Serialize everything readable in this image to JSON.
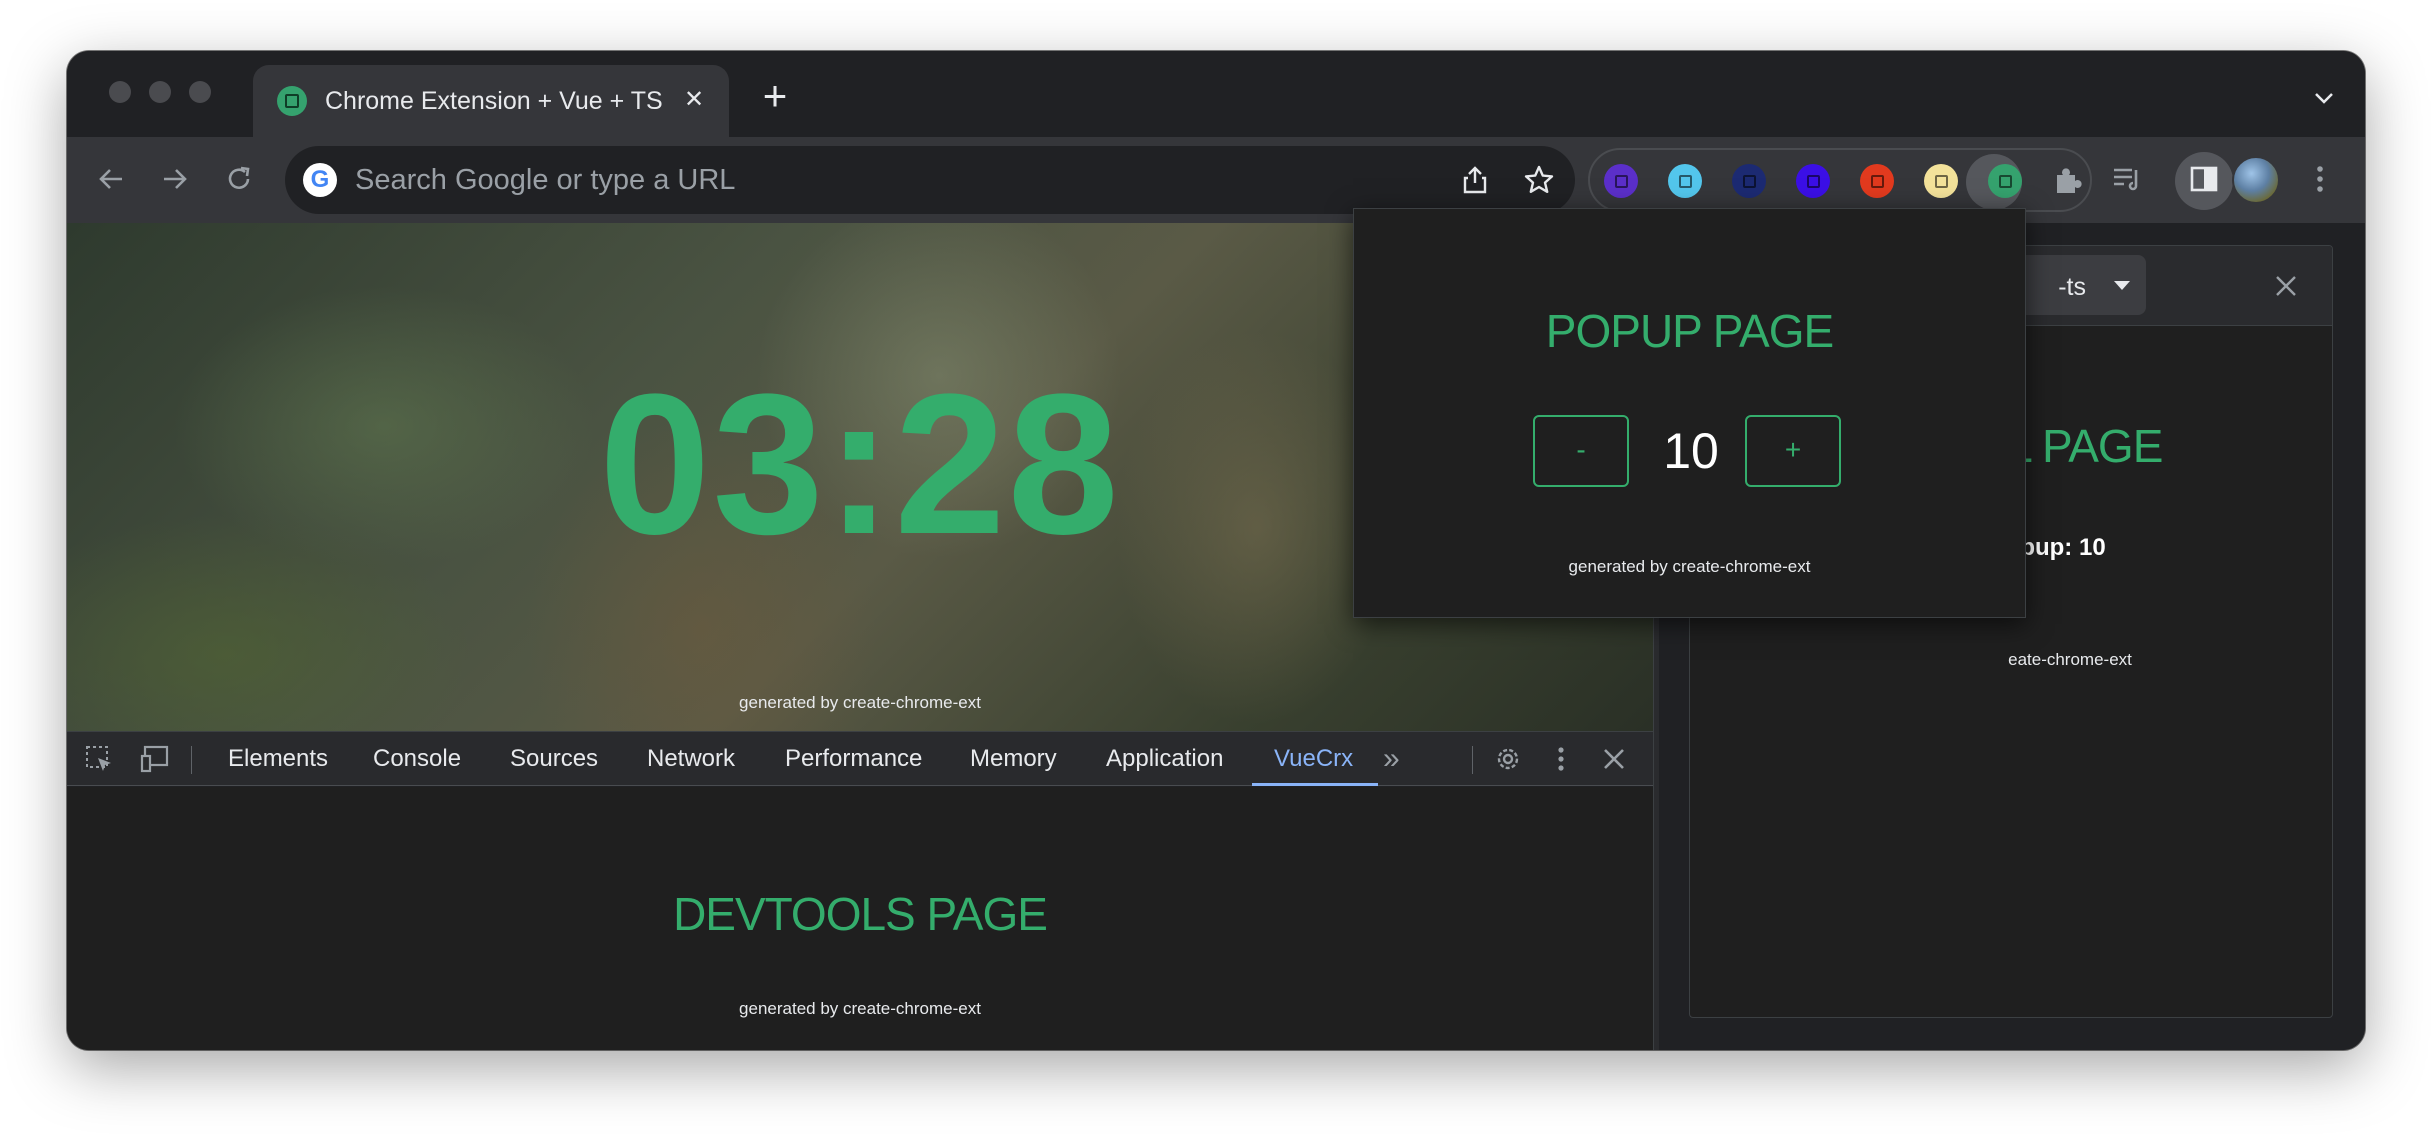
{
  "browser": {
    "tab": {
      "title": "Chrome Extension + Vue + TS",
      "close_glyph": "✕"
    },
    "new_tab_glyph": "+",
    "omnibox": {
      "placeholder": "Search Google or type a URL",
      "google_glyph": "G"
    },
    "extensions": [
      {
        "name": "extension-purple",
        "color": "#5b2fc9"
      },
      {
        "name": "extension-cyan",
        "color": "#53c6ec"
      },
      {
        "name": "extension-navy",
        "color": "#1c2a72"
      },
      {
        "name": "extension-violet",
        "color": "#3b0fe6"
      },
      {
        "name": "extension-red",
        "color": "#e23a1e"
      },
      {
        "name": "extension-yellow",
        "color": "#f3e29a"
      },
      {
        "name": "extension-green-active",
        "color": "#35a26e"
      }
    ]
  },
  "newtab": {
    "clock": "03:28",
    "footer": "generated by create-chrome-ext"
  },
  "devtools": {
    "tabs": [
      "Elements",
      "Console",
      "Sources",
      "Network",
      "Performance",
      "Memory",
      "Application",
      "VueCrx"
    ],
    "active_tab": "VueCrx",
    "more_glyph": "»",
    "content": {
      "title": "DEVTOOLS PAGE",
      "footer": "generated by create-chrome-ext"
    }
  },
  "sidepanel": {
    "select_value": "-ts",
    "title": "EL PAGE",
    "count_text": "n Popup: 10",
    "footer": "eate-chrome-ext"
  },
  "popup": {
    "title": "POPUP PAGE",
    "minus_label": "-",
    "plus_label": "+",
    "count": "10",
    "footer": "generated by create-chrome-ext"
  },
  "colors": {
    "accent_green": "#34ad6c",
    "devtools_active_blue": "#8ab4f8",
    "chrome_dark": "#202124",
    "toolbar": "#35363a"
  }
}
